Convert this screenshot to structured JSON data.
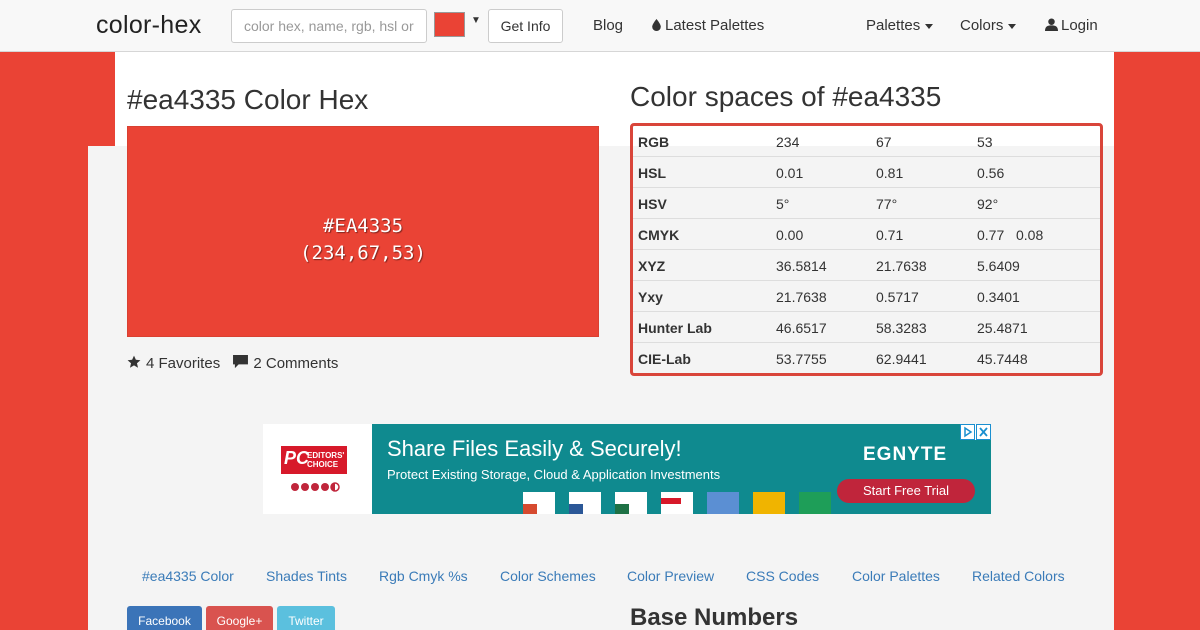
{
  "navbar": {
    "brand": "color-hex",
    "search_placeholder": "color hex, name, rgb, hsl or",
    "swatch_color": "#ea4335",
    "get_info_label": "Get Info",
    "links": {
      "blog": "Blog",
      "latest_palettes": "Latest Palettes",
      "palettes": "Palettes",
      "colors": "Colors",
      "login": "Login"
    }
  },
  "main": {
    "title": "#ea4335 Color Hex",
    "swatch": {
      "color": "#ea4335",
      "hex_label": "#EA4335",
      "rgb_label": "(234,67,53)"
    },
    "favorites": "4 Favorites",
    "comments": "2 Comments"
  },
  "color_spaces": {
    "title": "Color spaces of #ea4335",
    "rows": [
      {
        "label": "RGB",
        "v1": "234",
        "v2": "67",
        "v3": "53",
        "v4": ""
      },
      {
        "label": "HSL",
        "v1": "0.01",
        "v2": "0.81",
        "v3": "0.56",
        "v4": ""
      },
      {
        "label": "HSV",
        "v1": "5°",
        "v2": "77°",
        "v3": "92°",
        "v4": ""
      },
      {
        "label": "CMYK",
        "v1": "0.00",
        "v2": "0.71",
        "v3": "0.77",
        "v4": "0.08"
      },
      {
        "label": "XYZ",
        "v1": "36.5814",
        "v2": "21.7638",
        "v3": "5.6409",
        "v4": ""
      },
      {
        "label": "Yxy",
        "v1": "21.7638",
        "v2": "0.5717",
        "v3": "0.3401",
        "v4": ""
      },
      {
        "label": "Hunter Lab",
        "v1": "46.6517",
        "v2": "58.3283",
        "v3": "25.4871",
        "v4": ""
      },
      {
        "label": "CIE-Lab",
        "v1": "53.7755",
        "v2": "62.9441",
        "v3": "45.7448",
        "v4": ""
      }
    ]
  },
  "ad": {
    "badge_pc": "PC",
    "badge_editors": "EDITORS'",
    "badge_choice": "CHOICE",
    "headline": "Share Files Easily & Securely!",
    "subline": "Protect Existing Storage, Cloud & Application Investments",
    "brand": "EGNYTE",
    "cta": "Start Free Trial"
  },
  "tabs": [
    "#ea4335 Color",
    "Shades Tints",
    "Rgb Cmyk %s",
    "Color Schemes",
    "Color Preview",
    "CSS Codes",
    "Color Palettes",
    "Related Colors"
  ],
  "share": {
    "facebook": "Facebook",
    "google": "Google+",
    "twitter": "Twitter"
  },
  "base_numbers_title": "Base Numbers"
}
